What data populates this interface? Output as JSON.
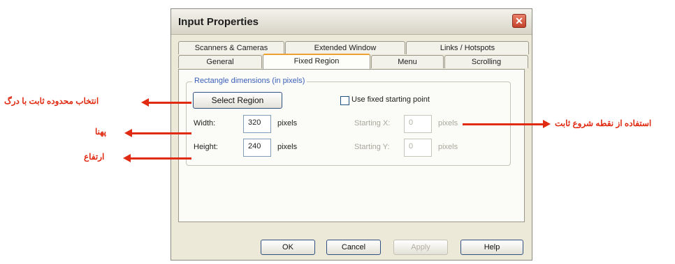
{
  "dialog": {
    "title": "Input Properties",
    "close_symbol": "✕"
  },
  "tabs": {
    "row1": [
      "Scanners & Cameras",
      "Extended Window",
      "Links / Hotspots"
    ],
    "row2": [
      "General",
      "Fixed Region",
      "Menu",
      "Scrolling"
    ],
    "active": "Fixed Region"
  },
  "group": {
    "legend": "Rectangle dimensions (in pixels)",
    "select_region_label": "Select Region",
    "width_label": "Width:",
    "width_value": "320",
    "width_unit": "pixels",
    "height_label": "Height:",
    "height_value": "240",
    "height_unit": "pixels",
    "fixed_start_label": "Use fixed starting point",
    "fixed_start_checked": false,
    "start_x_label": "Starting X:",
    "start_x_value": "0",
    "start_x_unit": "pixels",
    "start_y_label": "Starting Y:",
    "start_y_value": "0",
    "start_y_unit": "pixels"
  },
  "buttons": {
    "ok": "OK",
    "cancel": "Cancel",
    "apply": "Apply",
    "help": "Help"
  },
  "annotations": {
    "select_region_note": "انتخاب محدوده ثابت با درگ",
    "width_note": "پهنا",
    "height_note": "ارتفاع",
    "fixed_start_note": "استفاده از نقطه شروع ثابت",
    "arrow_color": "#e02a12"
  }
}
